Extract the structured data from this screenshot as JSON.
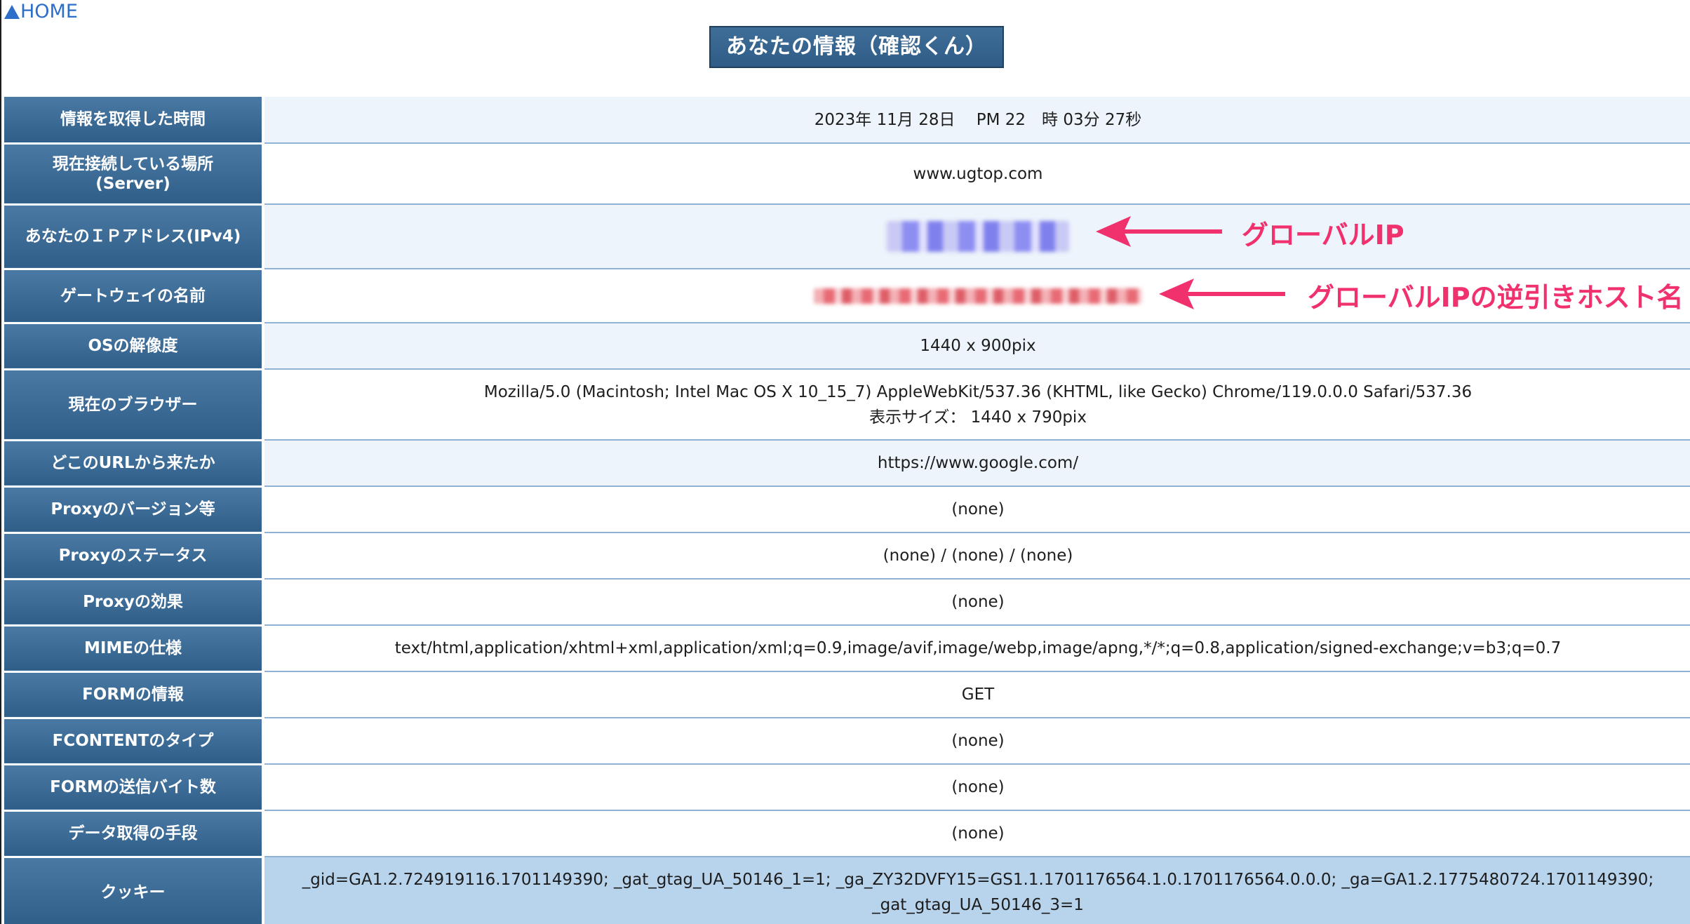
{
  "nav": {
    "home_label": "HOME"
  },
  "page_title": "あなたの情報（確認くん）",
  "rows": [
    {
      "label": "情報を取得した時間",
      "value": "2023年 11月 28日　 PM 22　時 03分 27秒"
    },
    {
      "label": "現在接続している場所",
      "label2": "(Server)",
      "value": "www.ugtop.com"
    },
    {
      "label": "あなたのＩＰアドレス(IPv4)",
      "value": ""
    },
    {
      "label": "ゲートウェイの名前",
      "value": ""
    },
    {
      "label": "OSの解像度",
      "value": "1440 x 900pix"
    },
    {
      "label": "現在のブラウザー",
      "value": "Mozilla/5.0 (Macintosh; Intel Mac OS X 10_15_7) AppleWebKit/537.36 (KHTML, like Gecko) Chrome/119.0.0.0 Safari/537.36",
      "value2": "表示サイズ：  1440 x 790pix"
    },
    {
      "label": "どこのURLから来たか",
      "value": "https://www.google.com/"
    },
    {
      "label": "Proxyのバージョン等",
      "value": "(none)"
    },
    {
      "label": "Proxyのステータス",
      "value": "(none) / (none) / (none)"
    },
    {
      "label": "Proxyの効果",
      "value": "(none)"
    },
    {
      "label": "MIMEの仕様",
      "value": "text/html,application/xhtml+xml,application/xml;q=0.9,image/avif,image/webp,image/apng,*/*;q=0.8,application/signed-exchange;v=b3;q=0.7"
    },
    {
      "label": "FORMの情報",
      "value": "GET"
    },
    {
      "label": "FCONTENTのタイプ",
      "value": "(none)"
    },
    {
      "label": "FORMの送信バイト数",
      "value": "(none)"
    },
    {
      "label": "データ取得の手段",
      "value": "(none)"
    },
    {
      "label": "クッキー",
      "value": "_gid=GA1.2.724919116.1701149390; _gat_gtag_UA_50146_1=1; _ga_ZY32DVFY15=GS1.1.1701176564.1.0.1701176564.0.0.0; _ga=GA1.2.1775480724.1701149390;",
      "value2": "_gat_gtag_UA_50146_3=1"
    }
  ],
  "annotations": {
    "ip_label": "グローバルIP",
    "host_label": "グローバルIPの逆引きホスト名",
    "color": "#f0316e"
  },
  "colors": {
    "label_bg": "#3a6893",
    "link": "#2d6fc8",
    "alt_row": "#edf4fb",
    "cookie_row": "#b8d3ec"
  }
}
